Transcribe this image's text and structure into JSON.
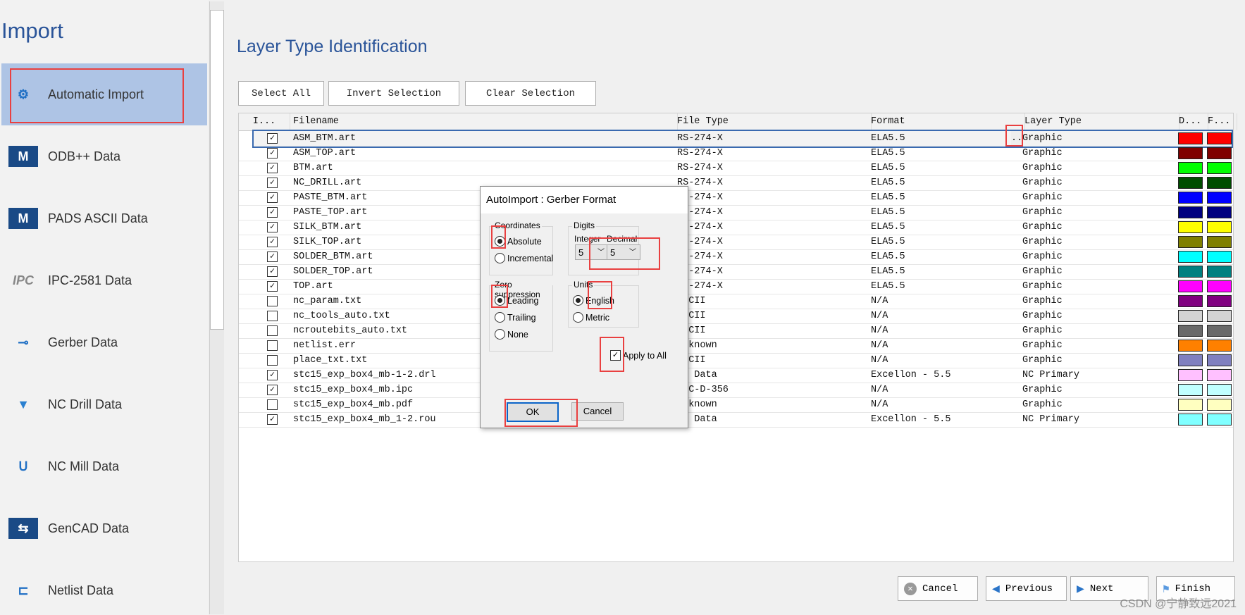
{
  "sidebar": {
    "title": "Import",
    "items": [
      {
        "label": "Automatic Import",
        "icon": "gears-icon",
        "selected": true
      },
      {
        "label": "ODB++ Data",
        "icon": "mentor-m-icon"
      },
      {
        "label": "PADS ASCII Data",
        "icon": "mentor-m-icon"
      },
      {
        "label": "IPC-2581 Data",
        "icon": "ipc-icon"
      },
      {
        "label": "Gerber Data",
        "icon": "gerber-icon"
      },
      {
        "label": "NC Drill Data",
        "icon": "drill-icon"
      },
      {
        "label": "NC Mill Data",
        "icon": "mill-icon"
      },
      {
        "label": "GenCAD Data",
        "icon": "gencad-icon"
      },
      {
        "label": "Netlist Data",
        "icon": "netlist-icon"
      }
    ]
  },
  "main": {
    "title": "Layer Type Identification",
    "toolbar": {
      "select_all": "Select All",
      "invert": "Invert Selection",
      "clear": "Clear Selection"
    },
    "table": {
      "headers": [
        "I...",
        "Filename",
        "File Type",
        "Format",
        "Layer Type",
        "D...",
        "F..."
      ],
      "rows": [
        {
          "checked": true,
          "filename": "ASM_BTM.art",
          "filetype": "RS-274-X",
          "format": "ELA5.5",
          "ellipsis": "..",
          "layer": "Graphic",
          "color": "#ff0000"
        },
        {
          "checked": true,
          "filename": "ASM_TOP.art",
          "filetype": "RS-274-X",
          "format": "ELA5.5",
          "layer": "Graphic",
          "color": "#800000"
        },
        {
          "checked": true,
          "filename": "BTM.art",
          "filetype": "RS-274-X",
          "format": "ELA5.5",
          "layer": "Graphic",
          "color": "#00ff00"
        },
        {
          "checked": true,
          "filename": "NC_DRILL.art",
          "filetype": "RS-274-X",
          "format": "ELA5.5",
          "layer": "Graphic",
          "color": "#004d00"
        },
        {
          "checked": true,
          "filename": "PASTE_BTM.art",
          "filetype": "RS-274-X",
          "format": "ELA5.5",
          "layer": "Graphic",
          "color": "#0000ff"
        },
        {
          "checked": true,
          "filename": "PASTE_TOP.art",
          "filetype": "RS-274-X",
          "format": "ELA5.5",
          "layer": "Graphic",
          "color": "#000080"
        },
        {
          "checked": true,
          "filename": "SILK_BTM.art",
          "filetype": "RS-274-X",
          "format": "ELA5.5",
          "layer": "Graphic",
          "color": "#ffff00"
        },
        {
          "checked": true,
          "filename": "SILK_TOP.art",
          "filetype": "RS-274-X",
          "format": "ELA5.5",
          "layer": "Graphic",
          "color": "#808000"
        },
        {
          "checked": true,
          "filename": "SOLDER_BTM.art",
          "filetype": "RS-274-X",
          "format": "ELA5.5",
          "layer": "Graphic",
          "color": "#00ffff"
        },
        {
          "checked": true,
          "filename": "SOLDER_TOP.art",
          "filetype": "RS-274-X",
          "format": "ELA5.5",
          "layer": "Graphic",
          "color": "#008080"
        },
        {
          "checked": true,
          "filename": "TOP.art",
          "filetype": "RS-274-X",
          "format": "ELA5.5",
          "layer": "Graphic",
          "color": "#ff00ff"
        },
        {
          "checked": false,
          "filename": "nc_param.txt",
          "filetype": "ASCII",
          "format": "N/A",
          "layer": "Graphic",
          "color": "#800080"
        },
        {
          "checked": false,
          "filename": "nc_tools_auto.txt",
          "filetype": "ASCII",
          "format": "N/A",
          "layer": "Graphic",
          "color": "#d3d3d3"
        },
        {
          "checked": false,
          "filename": "ncroutebits_auto.txt",
          "filetype": "ASCII",
          "format": "N/A",
          "layer": "Graphic",
          "color": "#696969"
        },
        {
          "checked": false,
          "filename": "netlist.err",
          "filetype": "Unknown",
          "format": "N/A",
          "layer": "Graphic",
          "color": "#ff8000"
        },
        {
          "checked": false,
          "filename": "place_txt.txt",
          "filetype": "ASCII",
          "format": "N/A",
          "layer": "Graphic",
          "color": "#8080c0"
        },
        {
          "checked": true,
          "filename": "stc15_exp_box4_mb-1-2.drl",
          "filetype": "NC Data",
          "format": "Excellon - 5.5",
          "layer": "NC Primary",
          "color": "#ffc0ff"
        },
        {
          "checked": true,
          "filename": "stc15_exp_box4_mb.ipc",
          "filetype": "IPC-D-356",
          "format": "N/A",
          "layer": "Graphic",
          "color": "#c0ffff"
        },
        {
          "checked": false,
          "filename": "stc15_exp_box4_mb.pdf",
          "filetype": "Unknown",
          "format": "N/A",
          "layer": "Graphic",
          "color": "#ffffc0"
        },
        {
          "checked": true,
          "filename": "stc15_exp_box4_mb_1-2.rou",
          "filetype": "NC Data",
          "format": "Excellon - 5.5",
          "layer": "NC Primary",
          "color": "#80ffff"
        }
      ]
    }
  },
  "dialog": {
    "title": "AutoImport : Gerber Format",
    "coordinates": {
      "label": "Coordinates",
      "absolute": "Absolute",
      "incremental": "Incremental",
      "selected": "Absolute"
    },
    "digits": {
      "label": "Digits",
      "integer_label": "Integer",
      "decimal_label": "Decimal",
      "integer": "5",
      "decimal": "5"
    },
    "zero": {
      "label": "Zero suppression",
      "leading": "Leading",
      "trailing": "Trailing",
      "none": "None",
      "selected": "Leading"
    },
    "units": {
      "label": "Units",
      "english": "English",
      "metric": "Metric",
      "selected": "English"
    },
    "apply_all": {
      "label": "Apply to All",
      "checked": true
    },
    "ok": "OK",
    "cancel": "Cancel"
  },
  "footer": {
    "cancel": "Cancel",
    "previous": "Previous",
    "next": "Next",
    "finish": "Finish"
  },
  "watermark": "CSDN @宁静致远2021"
}
